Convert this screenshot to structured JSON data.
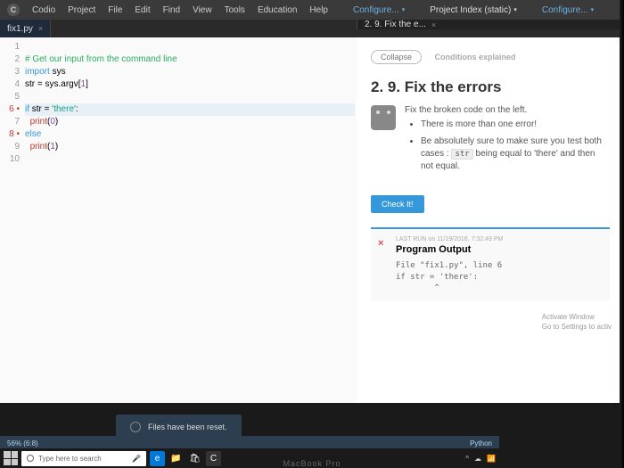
{
  "menubar": {
    "app": "Codio",
    "items": [
      "Project",
      "File",
      "Edit",
      "Find",
      "View",
      "Tools",
      "Education",
      "Help"
    ],
    "configure1": "Configure...",
    "project_index": "Project Index (static)",
    "configure2": "Configure..."
  },
  "tabs": {
    "left": "fix1.py",
    "right": "2. 9. Fix the e..."
  },
  "editor": {
    "lines": [
      {
        "n": "1",
        "txt": ""
      },
      {
        "n": "2",
        "txt": "# Get our input from the command line",
        "cls": "c-comment"
      },
      {
        "n": "3",
        "raw": true,
        "html": "<span class=\"c-kw\">import</span> sys"
      },
      {
        "n": "4",
        "raw": true,
        "html": "str = sys.argv[<span class=\"c-num\">1</span>]"
      },
      {
        "n": "5",
        "txt": ""
      },
      {
        "n": "6",
        "err": true,
        "hl": true,
        "raw": true,
        "html": "<span class=\"c-kw\">if</span> str = <span class=\"c-str\">'there'</span>:"
      },
      {
        "n": "7",
        "raw": true,
        "html": "  <span class=\"c-fn\">print</span>(<span class=\"c-num\">0</span>)"
      },
      {
        "n": "8",
        "err": true,
        "raw": true,
        "html": "<span class=\"c-kw\">else</span>"
      },
      {
        "n": "9",
        "raw": true,
        "html": "  <span class=\"c-fn\">print</span>(<span class=\"c-num\">1</span>)"
      },
      {
        "n": "10",
        "txt": ""
      }
    ]
  },
  "panel": {
    "collapse": "Collapse",
    "conditions": "Conditions explained",
    "title": "2. 9. Fix the errors",
    "intro": "Fix the broken code on the left.",
    "bullets": [
      "There is more than one error!",
      "Be absolutely sure to make sure you test both cases : |str| being equal to 'there' and then not equal."
    ],
    "check": "Check It!",
    "output": {
      "meta": "LAST RUN on 11/19/2018, 7:32:49 PM",
      "title": "Program Output",
      "text": "File \"fix1.py\", line 6\nif str = 'there':\n        ^"
    }
  },
  "toast": "Files have been reset.",
  "statusbar": {
    "left": "56%  (6:8)",
    "right": "Python"
  },
  "taskbar": {
    "search": "Type here to search"
  },
  "watermark": {
    "l1": "Activate Window",
    "l2": "Go to Settings to activ"
  },
  "macbook": "MacBook Pro"
}
